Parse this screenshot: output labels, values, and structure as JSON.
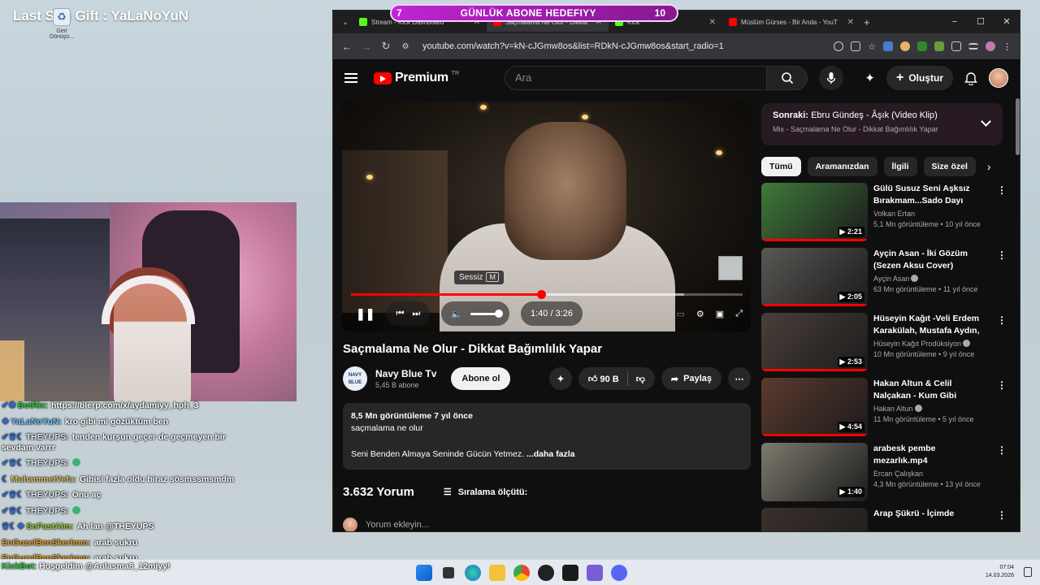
{
  "overlay": {
    "title": "Last Sub Gift : YaLaNoYuN",
    "desktop_icon_label": "Geri Dönüşü..."
  },
  "goal": {
    "current": "7",
    "label": "GÜNLÜK ABONE HEDEFIYY",
    "target": "10",
    "progress_fraction": 0.7
  },
  "chat": [
    {
      "user": "BotRix:",
      "text": "https://blerp.com/x/aydamiyy_hph_3",
      "cls": "botrix"
    },
    {
      "user": "YaLaNoYuN:",
      "text": "kro gibi mi gözüktüm ben",
      "cls": "yala"
    },
    {
      "user": "THEYUPS:",
      "text": "tenden kurşun geçer de geçmeyen bir sevdam varrr",
      "cls": "they"
    },
    {
      "user": "THEYUPS:",
      "text": "",
      "cls": "they"
    },
    {
      "user": "MuhammetVefa:",
      "text": "Gibisi fazla oldu biraz sösmssmsmdm",
      "cls": "muh"
    },
    {
      "user": "THEYUPS:",
      "text": "Onu aç",
      "cls": "they"
    },
    {
      "user": "THEYUPS:",
      "text": "",
      "cls": "they"
    },
    {
      "user": "SoFastAim:",
      "text": "Ah lan @THEYUPS",
      "cls": "sofast"
    },
    {
      "user": "EnGuzelBenSkerimm:",
      "text": "arab sukru",
      "cls": "engu"
    },
    {
      "user": "EnGuzelBenSkerimm:",
      "text": "arab sukru",
      "cls": "engu"
    }
  ],
  "kickbot": {
    "user": "KickBot:",
    "text": "Hoşgeldim @Anlasma8_12miyy!"
  },
  "browser": {
    "tabs": [
      {
        "label": "Stream - Kick Dashboard",
        "color": "#53fc18"
      },
      {
        "label": "Saçmalama Ne Olur - Dikkat",
        "color": "#ff0000"
      },
      {
        "label": "Kick",
        "color": "#53fc18"
      },
      {
        "label": "Müslüm Gürses - Bir Anda - YouT",
        "color": "#ff0000"
      }
    ],
    "url": "youtube.com/watch?v=kN-cJGmw8os&list=RDkN-cJGmw8os&start_radio=1",
    "new_tab": "+",
    "minimize": "−",
    "maximize": "☐",
    "close": "✕"
  },
  "youtube": {
    "logo": "Premium",
    "region": "TR",
    "search_placeholder": "Ara",
    "create_label": "Oluştur",
    "player": {
      "mute_tooltip": "Sessiz",
      "mute_key": "M",
      "time": "1:40 / 3:26",
      "progress_fraction": 0.485,
      "buffered_fraction": 0.85,
      "volume_fraction": 0.6
    },
    "video": {
      "title": "Saçmalama Ne Olur - Dikkat Bağımlılık Yapar",
      "channel": "Navy Blue Tv",
      "channel_avatar_text": "NAVY BLUE",
      "subscribers": "5,45 B abone",
      "subscribe_label": "Abone ol",
      "likes": "90 B",
      "share_label": "Paylaş",
      "views_date": "8,5 Mn görüntüleme  7 yıl önce",
      "desc_line1": "saçmalama ne olur",
      "desc_line2": "Seni Benden Almaya Seninde Gücün Yetmez.",
      "more_label": "...daha fazla"
    },
    "comments": {
      "count": "3.632 Yorum",
      "sort_label": "Sıralama ölçütü:",
      "input_placeholder": "Yorum ekleyin..."
    },
    "up_next": {
      "label": "Sonraki:",
      "title": "Ebru Gündeş - Âşık (Video Klip)",
      "mix": "Mix - Saçmalama Ne Olur - Dikkat Bağımlılık Yapar"
    },
    "chips": [
      "Tümü",
      "Aramanızdan",
      "İlgili",
      "Size özel"
    ],
    "recommendations": [
      {
        "title": "Gülü Susuz Seni Aşksız Bırakmam...Sado Dayı",
        "channel": "Volkan Ertan",
        "verified": false,
        "meta": "5,1 Mn görüntüleme • 10 yıl önce",
        "duration": "2:21",
        "thumb": "#3f7a3a",
        "watched": 1.0
      },
      {
        "title": "Ayçin Asan - İki Gözüm (Sezen Aksu Cover)",
        "channel": "Ayçin Asan",
        "verified": true,
        "meta": "63 Mn görüntüleme • 11 yıl önce",
        "duration": "2:05",
        "thumb": "#5a5855",
        "watched": 1.0
      },
      {
        "title": "Hüseyin Kağıt -Veli Erdem Karakülah, Mustafa Aydın, ...",
        "channel": "Hüseyin Kağıt Prodüksiyon",
        "verified": true,
        "meta": "10 Mn görüntüleme • 9 yıl önce",
        "duration": "2:53",
        "thumb": "#4a3f3a",
        "watched": 1.0
      },
      {
        "title": "Hakan Altun & Celil Nalçakan - Kum Gibi",
        "channel": "Hakan Altun",
        "verified": true,
        "meta": "11 Mn görüntüleme • 5 yıl önce",
        "duration": "4:54",
        "thumb": "#5b3a2e",
        "watched": 1.0
      },
      {
        "title": "arabesk pembe mezarlık.mp4",
        "channel": "Ercan Çalışkan",
        "verified": false,
        "meta": "4,3 Mn görüntüleme • 13 yıl önce",
        "duration": "1:40",
        "thumb": "#7e7a6e",
        "watched": 0
      },
      {
        "title": "Arap Şükrü - İçimde",
        "channel": "",
        "verified": false,
        "meta": "",
        "duration": "",
        "thumb": "#3a302c",
        "watched": 0
      }
    ]
  },
  "taskbar": {
    "time": "07:04",
    "date": "14.03.2026"
  }
}
